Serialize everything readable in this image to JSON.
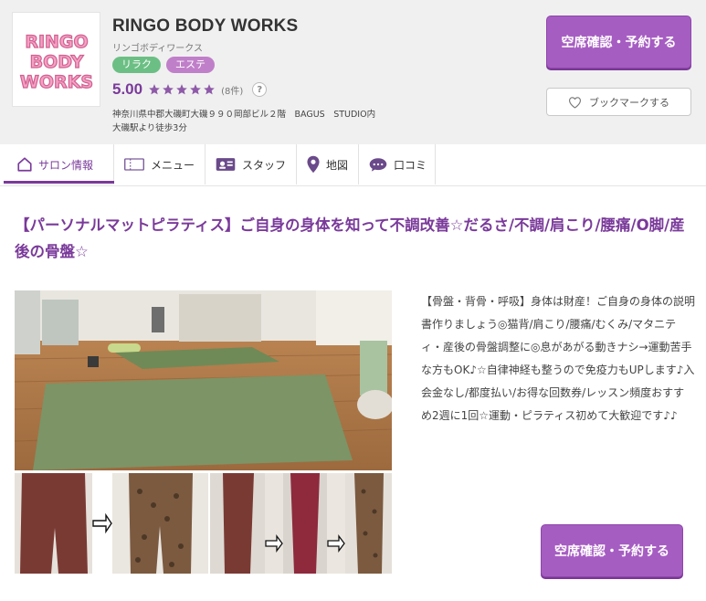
{
  "salon": {
    "name": "RINGO BODY WORKS",
    "kana": "リンゴボディワークス",
    "tags": [
      "リラク",
      "エステ"
    ],
    "rating": "5.00",
    "stars": 5,
    "review_count": "(8件)",
    "help": "?",
    "address": "神奈川県中郡大磯町大磯９９０岡部ビル２階　BAGUS　STUDIO内",
    "access": "大磯駅より徒歩3分",
    "logo_text": [
      "RINGO",
      "BODY",
      "WORKS"
    ]
  },
  "buttons": {
    "reserve": "空席確認・予約する",
    "bookmark": "ブックマークする",
    "reserve_bottom": "空席確認・予約する"
  },
  "tabs": [
    {
      "label": "サロン情報",
      "icon": "home-icon"
    },
    {
      "label": "メニュー",
      "icon": "ticket-icon"
    },
    {
      "label": "スタッフ",
      "icon": "staff-card-icon"
    },
    {
      "label": "地図",
      "icon": "map-pin-icon"
    },
    {
      "label": "口コミ",
      "icon": "chat-bubble-icon"
    }
  ],
  "catch_copy": "【パーソナルマットピラティス】ご自身の身体を知って不調改善☆だるさ/不調/肩こり/腰痛/O脚/産後の骨盤☆",
  "description": "【骨盤・背骨・呼吸】身体は財産！ご自身の身体の説明書作りましょう◎猫背/肩こり/腰痛/むくみ/マタニティ・産後の骨盤調整に◎息があがる動きナシ→運動苦手な方もOK♪☆自律神経も整うので免疫力もUPします♪入会金なし/都度払い/お得な回数券/レッスン頻度おすすめ2週に1回☆運動・ピラティス初めて大歓迎です♪♪",
  "colors": {
    "accent": "#7a3a9a",
    "button": "#a65dc2",
    "tag_green": "#6cbf84",
    "tag_purple": "#c07fc9",
    "star": "#8e5aa8"
  }
}
